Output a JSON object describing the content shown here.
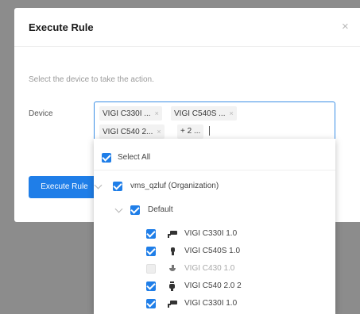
{
  "modal": {
    "title": "Execute Rule",
    "close_glyph": "×",
    "description": "Select the device to take the action.",
    "device_label": "Device",
    "execute_button": "Execute Rule"
  },
  "device_select": {
    "tags": [
      "VIGI C330I ...",
      "VIGI C540S ...",
      "VIGI C540 2..."
    ],
    "more": "+ 2 ...",
    "tag_remove_glyph": "×"
  },
  "dropdown": {
    "select_all": "Select All",
    "organization": "vms_qzluf (Organization)",
    "group": "Default",
    "devices": [
      {
        "label": "VIGI C330I 1.0",
        "checked": true,
        "icon": "bullet-camera-icon"
      },
      {
        "label": "VIGI C540S 1.0",
        "checked": true,
        "icon": "turret-camera-icon"
      },
      {
        "label": "VIGI C430 1.0",
        "checked": false,
        "icon": "dome-camera-icon"
      },
      {
        "label": "VIGI C540 2.0 2",
        "checked": true,
        "icon": "ptz-camera-icon"
      },
      {
        "label": "VIGI C330I 1.0",
        "checked": true,
        "icon": "bullet-camera-icon"
      }
    ]
  },
  "colors": {
    "accent": "#1f7ee8",
    "overlay": "#8c8c8c"
  }
}
